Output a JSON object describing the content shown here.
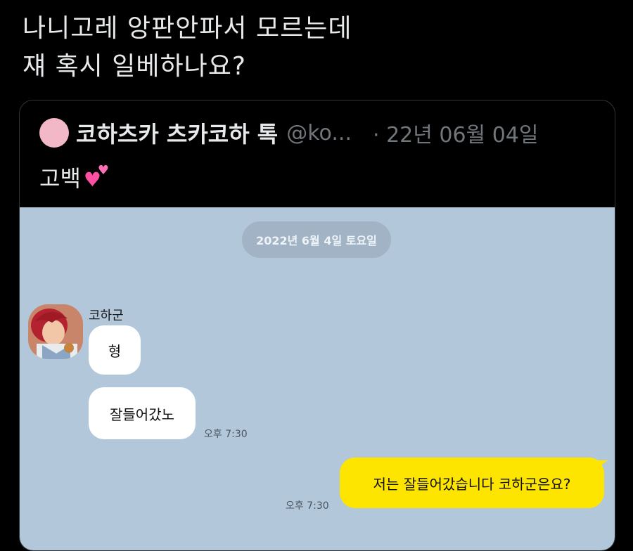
{
  "tweet": {
    "line1": "나니고레 앙판안파서 모르는데",
    "line2": "쟤 혹시 일베하나요?"
  },
  "quote": {
    "display_name": "코하츠카 츠카코하 톡",
    "handle": "@ko...",
    "date": "· 22년 06월 04일",
    "text": "고백",
    "emoji_icon": "two-hearts-icon",
    "avatar_color": "#f3b8c8"
  },
  "chat": {
    "background_color": "#b2c7da",
    "date_label": "2022년 6월 4일 토요일",
    "sender_name": "코하군",
    "messages": [
      {
        "from": "other",
        "text": "형"
      },
      {
        "from": "other",
        "text": "잘들어갔노"
      },
      {
        "from": "me",
        "text": "저는 잘들어갔습니다 코하군은요?"
      }
    ],
    "time_other": "오후 7:30",
    "time_mine": "오후 7:30",
    "my_bubble_color": "#fee500"
  }
}
